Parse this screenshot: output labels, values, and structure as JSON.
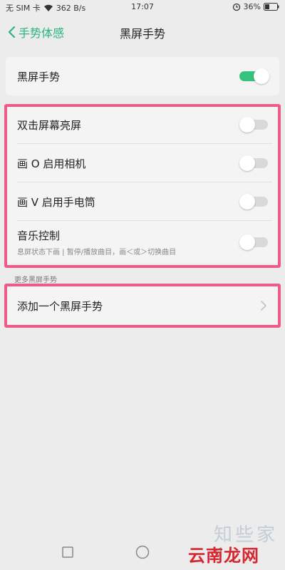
{
  "status_bar": {
    "carrier": "无 SIM 卡",
    "speed": "362 B/s",
    "time": "17:07",
    "battery": "36%"
  },
  "header": {
    "back_label": "手势体感",
    "title": "黑屏手势"
  },
  "main_toggle": {
    "label": "黑屏手势",
    "enabled": true
  },
  "gestures": [
    {
      "label": "双击屏幕亮屏",
      "enabled": false
    },
    {
      "label": "画 O 启用相机",
      "enabled": false
    },
    {
      "label": "画 V 启用手电筒",
      "enabled": false
    },
    {
      "label": "音乐控制",
      "sublabel": "息屏状态下画 | 暂停/播放曲目，画＜或＞切换曲目",
      "enabled": false
    }
  ],
  "more_section": {
    "header": "更多黑屏手势",
    "add_label": "添加一个黑屏手势"
  },
  "watermark": {
    "text": "云南龙网",
    "faint": "知些家"
  },
  "colors": {
    "accent": "#34c27d",
    "highlight": "#ec5c86"
  }
}
